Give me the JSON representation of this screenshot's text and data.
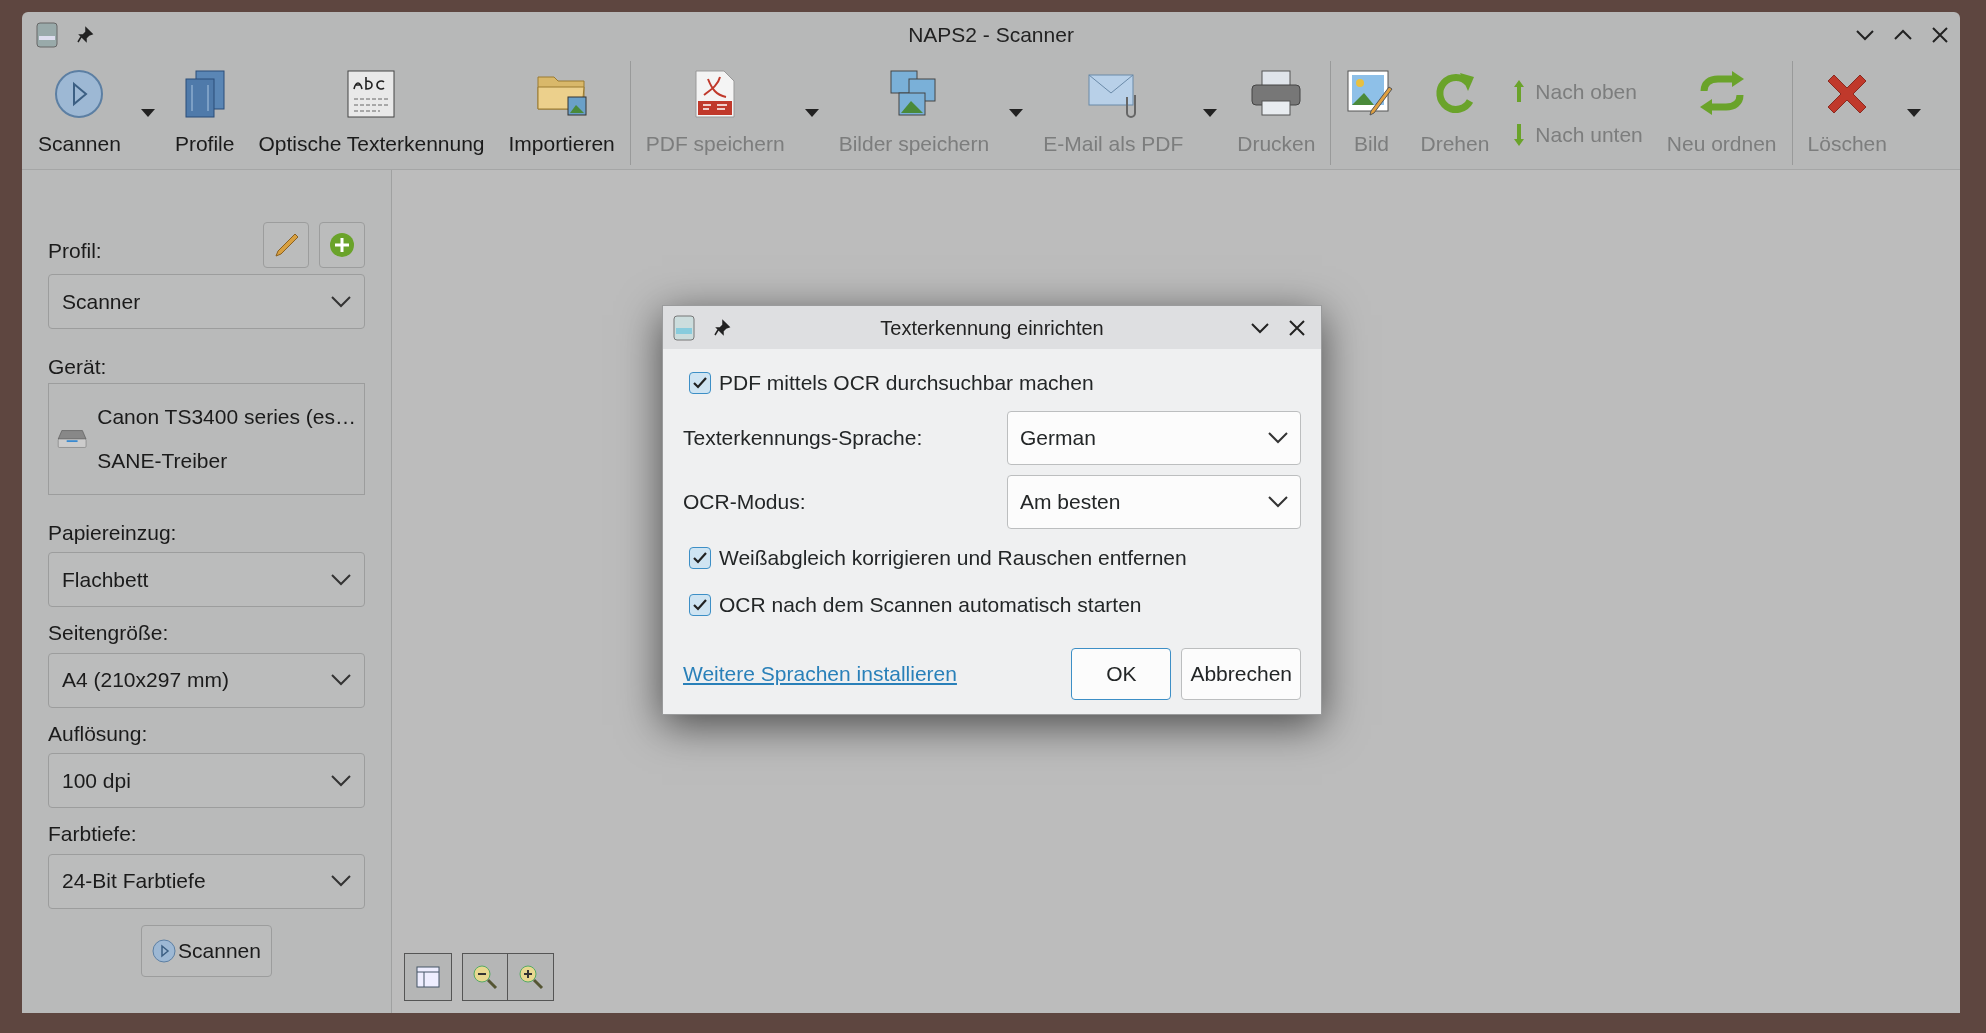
{
  "window": {
    "title": "NAPS2 - Scanner"
  },
  "toolbar": [
    {
      "kind": "button",
      "label": "Scannen",
      "disabled": false,
      "dropdown": true
    },
    {
      "kind": "button",
      "label": "Profile",
      "disabled": false,
      "dropdown": false
    },
    {
      "kind": "button",
      "label": "Optische Texterkennung",
      "disabled": false,
      "dropdown": false
    },
    {
      "kind": "button",
      "label": "Importieren",
      "disabled": false,
      "dropdown": false
    },
    {
      "kind": "separator"
    },
    {
      "kind": "button",
      "label": "PDF speichern",
      "disabled": true,
      "dropdown": true
    },
    {
      "kind": "button",
      "label": "Bilder speichern",
      "disabled": true,
      "dropdown": true
    },
    {
      "kind": "button",
      "label": "E-Mail als PDF",
      "disabled": true,
      "dropdown": true
    },
    {
      "kind": "button",
      "label": "Drucken",
      "disabled": true,
      "dropdown": false
    },
    {
      "kind": "separator"
    },
    {
      "kind": "button",
      "label": "Bild",
      "disabled": true,
      "dropdown": false
    },
    {
      "kind": "button",
      "label": "Drehen",
      "disabled": true,
      "dropdown": false
    },
    {
      "kind": "stack",
      "items": [
        {
          "label": "Nach oben",
          "disabled": true
        },
        {
          "label": "Nach unten",
          "disabled": true
        }
      ]
    },
    {
      "kind": "button",
      "label": "Neu ordnen",
      "disabled": true,
      "dropdown": false
    },
    {
      "kind": "separator"
    },
    {
      "kind": "button",
      "label": "Löschen",
      "disabled": true,
      "dropdown": true
    }
  ],
  "sidebar": {
    "profile_label": "Profil:",
    "profile_value": "Scanner",
    "device_label": "Gerät:",
    "device_name": "Canon TS3400 series (es…",
    "device_driver": "SANE-Treiber",
    "fields": [
      {
        "label": "Papiereinzug:",
        "value": "Flachbett"
      },
      {
        "label": "Seitengröße:",
        "value": "A4 (210x297 mm)"
      },
      {
        "label": "Auflösung:",
        "value": "100 dpi"
      },
      {
        "label": "Farbtiefe:",
        "value": "24-Bit Farbtiefe"
      }
    ],
    "scan_button": "Scannen"
  },
  "dialog": {
    "title": "Texterkennung einrichten",
    "rows": [
      {
        "kind": "checkbox",
        "label": "PDF mittels OCR durchsuchbar machen",
        "checked": true
      },
      {
        "kind": "select",
        "label": "Texterkennungs-Sprache:",
        "value": "German"
      },
      {
        "kind": "select",
        "label": "OCR-Modus:",
        "value": "Am besten"
      },
      {
        "kind": "checkbox",
        "label": "Weißabgleich korrigieren und Rauschen entfernen",
        "checked": true
      },
      {
        "kind": "checkbox",
        "label": "OCR nach dem Scannen automatisch starten",
        "checked": true
      }
    ],
    "link": "Weitere Sprachen installieren",
    "buttons": [
      {
        "label": "OK",
        "default": true
      },
      {
        "label": "Abbrechen",
        "default": false
      }
    ]
  }
}
